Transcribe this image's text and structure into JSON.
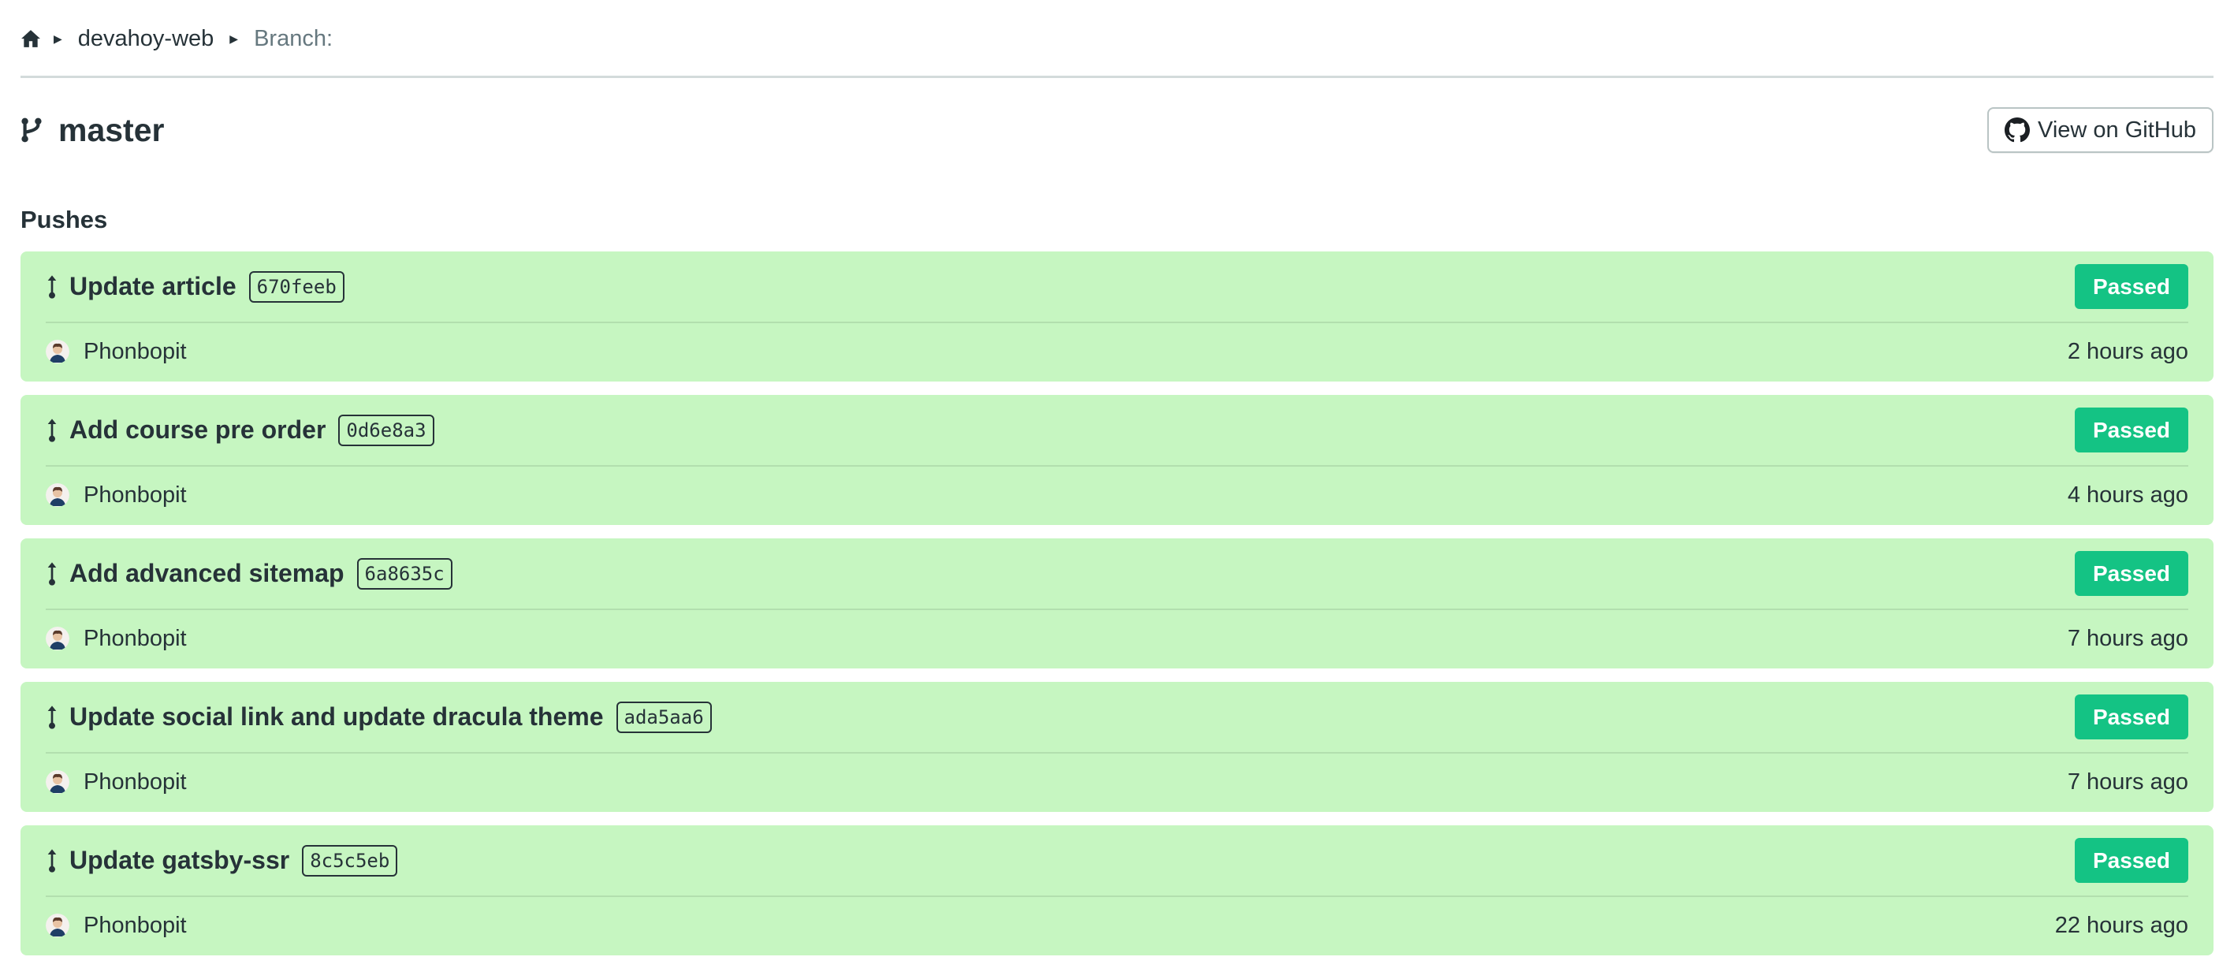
{
  "breadcrumb": {
    "home_icon": "home-icon",
    "items": [
      {
        "label": "devahoy-web"
      },
      {
        "label": "Branch:"
      }
    ]
  },
  "header": {
    "branch_icon": "git-branch-icon",
    "title": "master",
    "github_button": {
      "label": "View on GitHub",
      "icon": "github-icon"
    }
  },
  "pushes": {
    "section_title": "Pushes",
    "colors": {
      "card_bg": "#c6f6c1",
      "badge_bg": "#14c384"
    },
    "items": [
      {
        "title": "Update article",
        "hash": "670feeb",
        "status": "Passed",
        "author": "Phonbopit",
        "time": "2 hours ago"
      },
      {
        "title": "Add course pre order",
        "hash": "0d6e8a3",
        "status": "Passed",
        "author": "Phonbopit",
        "time": "4 hours ago"
      },
      {
        "title": "Add advanced sitemap",
        "hash": "6a8635c",
        "status": "Passed",
        "author": "Phonbopit",
        "time": "7 hours ago"
      },
      {
        "title": "Update social link and update dracula theme",
        "hash": "ada5aa6",
        "status": "Passed",
        "author": "Phonbopit",
        "time": "7 hours ago"
      },
      {
        "title": "Update gatsby-ssr",
        "hash": "8c5c5eb",
        "status": "Passed",
        "author": "Phonbopit",
        "time": "22 hours ago"
      }
    ]
  }
}
